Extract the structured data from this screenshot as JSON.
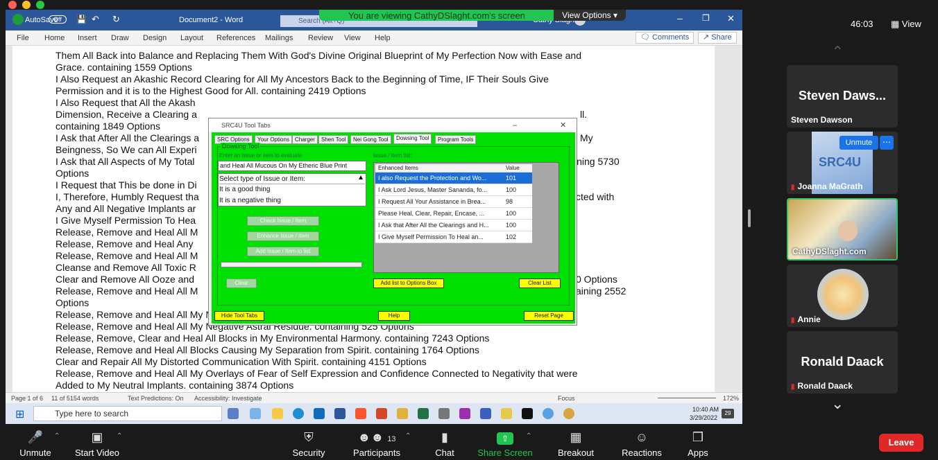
{
  "share_banner": {
    "message": "You are viewing CathyDSlaght.com's screen",
    "view_options": "View Options"
  },
  "word": {
    "autosave": "AutoSave",
    "autosave_state": "Off",
    "document_title": "Document2 - Word",
    "search_placeholder": "Search (Alt+Q)",
    "user_name": "Cathy Slaght",
    "user_initials": "CS",
    "menu": [
      "File",
      "Home",
      "Insert",
      "Draw",
      "Design",
      "Layout",
      "References",
      "Mailings",
      "Review",
      "View",
      "Help"
    ],
    "comments_label": "Comments",
    "share_label": "Share",
    "status": {
      "page": "Page 1 of 6",
      "words": "11 of 5154 words",
      "text_predictions": "Text Predictions: On",
      "accessibility": "Accessibility: Investigate",
      "focus": "Focus",
      "zoom": "172%"
    }
  },
  "document_lines": [
    "Them All Back into Balance and Replacing Them With God's Divine Original Blueprint of My Perfection Now with Ease and",
    "Grace. containing 1559 Options",
    "I Also Request an Akashic Record Clearing for All My Ancestors Back to the Beginning of Time, IF Their Souls Give",
    "Permission and it is to the Highest Good for All. containing 2419 Options",
    "I Also Request that All the Akash",
    "Dimension, Receive a Clearing a",
    "containing 1849 Options",
    "I Ask that After All the Clearings a",
    "Beingness, So We can All Experi",
    "I Ask that All Aspects of My Total",
    "Options",
    "I Request that This be done in Di",
    "I, Therefore, Humbly Request tha",
    "Any and All Negative Implants ar",
    "I Give Myself Permission To Hea",
    "Release, Remove and Heal All M",
    "Release, Remove and Heal Any",
    "Release, Remove and Heal All M",
    "Cleanse and Remove All Toxic R",
    "Clear and Remove All Ooze and",
    "Release, Remove and Heal All M",
    "Options",
    "Release, Remove and Heal All My Negative Belief Systems from My Past, Present and Future. containing 7702 Options",
    "Release, Remove and Heal All My Negative Astral Residue. containing 525 Options",
    "Release, Remove, Clear and Heal All Blocks in My Environmental Harmony. containing 7243 Options",
    "Release, Remove and Heal All Blocks Causing My Separation from Spirit. containing 1764 Options",
    "Clear and Repair All My Distorted Communication With Spirit. containing 4151 Options",
    "Release, Remove and Heal All My Overlays of Fear of Self Expression and Confidence Connected to Negativity that were",
    "Added to My Neutral Implants. containing 3874 Options"
  ],
  "doc_right_fragments": {
    "dimension_end": "ll.",
    "beingness_end": "My",
    "aspects_end": "ining 5730",
    "request_end": "cted with",
    "ooze_end": "0 Options",
    "release_end": "aining 2552"
  },
  "dialog": {
    "title": "SRC4U Tool Tabs",
    "tabs": [
      "SRC Options",
      "Your Options",
      "Charger",
      "Shen Tool",
      "Nei Gong Tool",
      "Dowsing Tool",
      "Program Tools"
    ],
    "active_tab": "Dowsing Tool",
    "group_title": "Dowsing Tool",
    "enter_label": "Enter an issue or item to evaluate",
    "issue_value": "and Heal All Mucous On My Etheric Blue Print",
    "select_type_label": "Select type of Issue or Item:",
    "type_options": [
      "It is a good thing",
      "It is a negative thing"
    ],
    "buttons": {
      "check": "Check Issue / Item",
      "enhance": "Enhance Issue / Item",
      "add": "Add Issue / Item to list",
      "clear": "Clear",
      "add_list": "Add list to Options Box",
      "clear_list": "Clear List",
      "hide": "Hide Tool Tabs",
      "help": "Help",
      "reset": "Reset Page"
    },
    "list_label": "Issue / Item list:",
    "list_headers": [
      "Enhanced Items",
      "Value"
    ],
    "list_rows": [
      {
        "item": "I also Request the Protection and Wo...",
        "value": "101"
      },
      {
        "item": "I Ask Lord Jesus, Master Sananda, fo...",
        "value": "100"
      },
      {
        "item": "I Request All Your Assistance in Brea...",
        "value": "98"
      },
      {
        "item": "Please Heal, Clear, Repair, Encase, ...",
        "value": "100"
      },
      {
        "item": "I Ask that After All the Clearings and H...",
        "value": "100"
      },
      {
        "item": "I Give Myself Permission To Heal an...",
        "value": "102"
      }
    ]
  },
  "taskbar": {
    "search_placeholder": "Type here to search",
    "time": "10:40 AM",
    "date": "3/29/2022",
    "notifications": "29"
  },
  "zoom": {
    "timer": "46:03",
    "view": "View",
    "participants": [
      {
        "big": "Steven Daws...",
        "name": "Steven Dawson",
        "muted": false
      },
      {
        "big": "",
        "name": "Joanna MaGrath",
        "muted": true,
        "unmute": "Unmute"
      },
      {
        "big": "",
        "name": "CathyDSlaght.com",
        "muted": false
      },
      {
        "big": "",
        "name": "Annie",
        "muted": true
      },
      {
        "big": "Ronald Daack",
        "name": "Ronald Daack",
        "muted": true
      }
    ],
    "toolbar": [
      {
        "label": "Unmute",
        "icon": "microphone-muted-icon"
      },
      {
        "label": "Start Video",
        "icon": "video-off-icon"
      },
      {
        "label": "Security",
        "icon": "shield-icon"
      },
      {
        "label": "Participants",
        "icon": "people-icon",
        "count": "13"
      },
      {
        "label": "Chat",
        "icon": "chat-icon"
      },
      {
        "label": "Share Screen",
        "icon": "share-screen-icon"
      },
      {
        "label": "Breakout Rooms",
        "icon": "grid-icon"
      },
      {
        "label": "Reactions",
        "icon": "emoji-icon"
      },
      {
        "label": "Apps",
        "icon": "apps-icon"
      }
    ],
    "leave": "Leave"
  }
}
